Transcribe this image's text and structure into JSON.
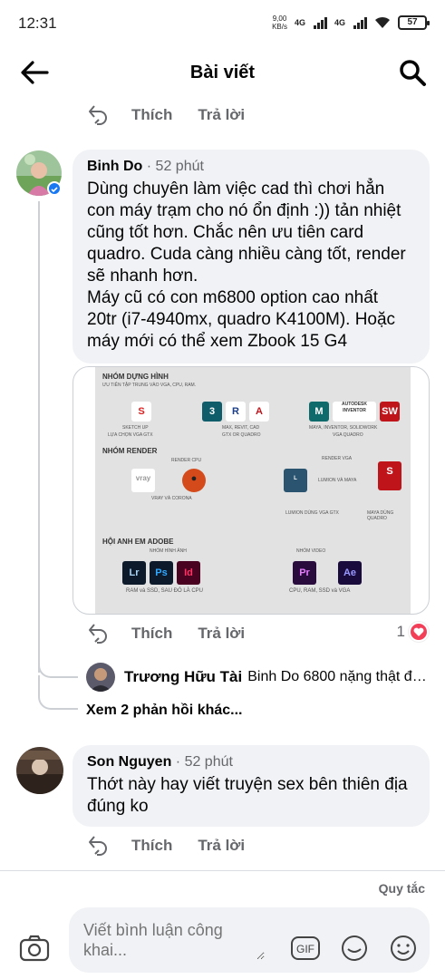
{
  "status_bar": {
    "time": "12:31",
    "speed_value": "9,00",
    "speed_unit": "KB/s",
    "network_1": "4G",
    "network_2": "4G",
    "battery": "57"
  },
  "header": {
    "title": "Bài viết",
    "back_icon": "arrow-left-icon",
    "search_icon": "search-icon"
  },
  "actions_labels": {
    "like": "Thích",
    "reply": "Trả lời"
  },
  "comments": [
    {
      "author": "Binh Do",
      "time": " · 52 phút",
      "text_lines": [
        "Dùng chuyên làm việc cad thì chơi hẳn",
        "con máy trạm cho nó ổn định :)) tản nhiệt",
        "cũng tốt hơn. Chắc nên ưu tiên card",
        "quadro. Cuda càng nhiều càng tốt, render",
        "sẽ nhanh hơn.",
        "Máy cũ có con m6800 option cao nhất",
        "20tr (i7-4940mx, quadro K4100M). Hoặc",
        "máy mới có thể xem Zbook 15 G4"
      ],
      "reaction_count": "1",
      "reply_preview": {
        "author": "Trương Hữu Tài",
        "text": "Binh Do 6800 nặng thật đấy..."
      },
      "more_replies": "Xem 2 phản hồi khác..."
    },
    {
      "author": "Son Nguyen",
      "time": " · 52 phút",
      "text_lines": [
        "Thớt này hay viết truyện sex bên thiên địa",
        "đúng ko"
      ]
    }
  ],
  "infographic": {
    "section_1": "NHÓM DỰNG HÌNH",
    "section_1_sub": "ƯU TIÊN TẬP TRUNG VÀO VGA, CPU, RAM.",
    "sketchup": "SKETCH UP",
    "sketchup_note": "LỰA CHỌN VGA GTX",
    "max": "MAX, REVIT, CAD",
    "max_note": "GTX OR QUADRO",
    "maya": "MAYA, INVENTOR, SOLIDWORK",
    "maya_note": "VGA QUADRO",
    "autodesk": "AUTODESK INVENTOR",
    "section_2": "NHÓM RENDER",
    "render_cpu": "RENDER CPU",
    "render_vga": "RENDER VGA",
    "vray": "VRAY VÀ CORONA",
    "lumion": "LUMION VÀ MAYA",
    "lumion_note": "LUMION DÙNG VGA GTX",
    "maya_render_note": "MAYA DÙNG QUADRO",
    "section_3": "HỘI ANH EM ADOBE",
    "image_group": "NHÓM HÌNH ẢNH",
    "video_group": "NHÓM VIDEO",
    "image_note": "RAM và SSD, SAU ĐÓ LÀ CPU",
    "video_note": "CPU, RAM, SSD và VGA",
    "lr": "Lr",
    "ps": "Ps",
    "id": "Id",
    "pr": "Pr",
    "ae": "Ae"
  },
  "footer": {
    "rules": "Quy tắc",
    "composer_placeholder": "Viết bình luận công khai...",
    "gif": "GIF"
  },
  "colors": {
    "bubble": "#f0f2f5",
    "secondary_text": "#65676b",
    "heart": "#f33e58",
    "online_badge": "#1877f2"
  }
}
